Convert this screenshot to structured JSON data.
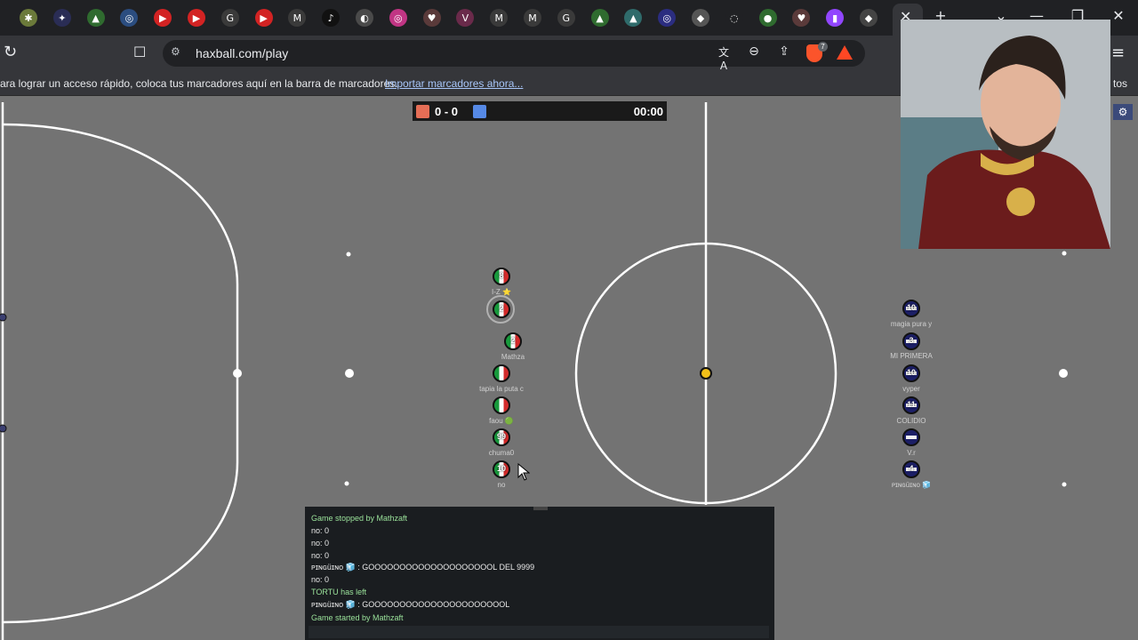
{
  "browser": {
    "tabs": [
      {
        "icon": "chat-app-icon",
        "color": "#6b7a3a",
        "glyph": "✱"
      },
      {
        "icon": "spark-app-icon",
        "color": "#2a2d55",
        "glyph": "✦"
      },
      {
        "icon": "drive-icon",
        "color": "#2f6b2f",
        "glyph": "▲"
      },
      {
        "icon": "network-icon",
        "color": "#2b4d80",
        "glyph": "◎"
      },
      {
        "icon": "youtube-icon",
        "color": "#d32323",
        "glyph": "▶"
      },
      {
        "icon": "youtube-icon",
        "color": "#d32323",
        "glyph": "▶"
      },
      {
        "icon": "google-icon",
        "color": "#3a3a3a",
        "glyph": "G"
      },
      {
        "icon": "youtube-icon",
        "color": "#d32323",
        "glyph": "▶"
      },
      {
        "icon": "gmail-icon",
        "color": "#3a3a3a",
        "glyph": "M"
      },
      {
        "icon": "tiktok-icon",
        "color": "#111111",
        "glyph": "♪"
      },
      {
        "icon": "generic-site-icon",
        "color": "#4a4a4a",
        "glyph": "◐"
      },
      {
        "icon": "instagram-icon",
        "color": "#c13584",
        "glyph": "◎"
      },
      {
        "icon": "shield-site-icon",
        "color": "#5a3a3a",
        "glyph": "♥"
      },
      {
        "icon": "v-site-icon",
        "color": "#6a2a4a",
        "glyph": "V"
      },
      {
        "icon": "gmail-icon",
        "color": "#3a3a3a",
        "glyph": "M"
      },
      {
        "icon": "gmail-icon",
        "color": "#3a3a3a",
        "glyph": "M"
      },
      {
        "icon": "google-icon",
        "color": "#3a3a3a",
        "glyph": "G"
      },
      {
        "icon": "drive-icon",
        "color": "#2f6b2f",
        "glyph": "▲"
      },
      {
        "icon": "drive-icon",
        "color": "#2f6b6b",
        "glyph": "▲"
      },
      {
        "icon": "network-icon",
        "color": "#2b2d80",
        "glyph": "◎"
      },
      {
        "icon": "chrome-store-icon",
        "color": "#555555",
        "glyph": "◆"
      },
      {
        "icon": "loading-icon",
        "color": "#202124",
        "glyph": "◌"
      },
      {
        "icon": "maps-icon",
        "color": "#2f6b2f",
        "glyph": "●"
      },
      {
        "icon": "shield-site-icon",
        "color": "#5a3a3a",
        "glyph": "♥"
      },
      {
        "icon": "twitch-icon",
        "color": "#9146ff",
        "glyph": "▮"
      },
      {
        "icon": "brave-tab-icon",
        "color": "#444444",
        "glyph": "◆"
      }
    ],
    "active_tab_close": "✕",
    "new_tab": "+",
    "tab_search": "⌄",
    "minimize": "—",
    "restore": "❐",
    "close": "✕",
    "reload": "↻",
    "bookmark": "☐",
    "site_info": "⚙",
    "url": "haxball.com/play",
    "translate": "文A",
    "zoom": "⊖",
    "share": "⇪",
    "brave_badge": "7",
    "menu": "≡",
    "bookmarks_prompt": "ara lograr un acceso rápido, coloca tus marcadores aquí en la barra de marcadores.",
    "bookmarks_import": "Importar marcadores ahora...",
    "bookmarks_right": "tos"
  },
  "game": {
    "score": "0 - 0",
    "timer": "00:00",
    "colors": {
      "red_team": "#e56e56",
      "blue_team": "#5689e5",
      "ball": "#f2c019"
    },
    "red_players": [
      {
        "avatar": "8",
        "name": "I-Z ⭐"
      },
      {
        "avatar": "2",
        "name": ""
      },
      {
        "avatar": "2",
        "name": "Mathza"
      },
      {
        "avatar": "",
        "name": "tapia la puta c"
      },
      {
        "avatar": "",
        "name": "faou 🟢"
      },
      {
        "avatar": "99",
        "name": "chuma0"
      },
      {
        "avatar": "10",
        "name": "no"
      }
    ],
    "blue_players": [
      {
        "avatar": "10",
        "name": "magia pura y"
      },
      {
        "avatar": "3",
        "name": "MI PRIMERA"
      },
      {
        "avatar": "10",
        "name": "vyper"
      },
      {
        "avatar": "11",
        "name": "COLIDIO"
      },
      {
        "avatar": "",
        "name": "V.r"
      },
      {
        "avatar": "4",
        "name": "ᴘɪɴɢüɪɴᴏ 🧊"
      }
    ],
    "settings_icon": "⚙"
  },
  "chat": {
    "lines": [
      {
        "text": "Game stopped by Mathzaft",
        "type": "sys"
      },
      {
        "text": "no: 0",
        "type": "msg"
      },
      {
        "text": "no: 0",
        "type": "msg"
      },
      {
        "text": "no: 0",
        "type": "msg"
      },
      {
        "text": "ᴘɪɴɢüɪɴᴏ 🧊 : GOOOOOOOOOOOOOOOOOOOOL DEL 9999",
        "type": "msg"
      },
      {
        "text": "no: 0",
        "type": "msg"
      },
      {
        "text": "TORTU has left",
        "type": "sys"
      },
      {
        "text": "ᴘɪɴɢüɪɴᴏ 🧊 : GOOOOOOOOOOOOOOOOOOOOOOL",
        "type": "msg"
      },
      {
        "text": "Game started by Mathzaft",
        "type": "sys"
      }
    ]
  }
}
